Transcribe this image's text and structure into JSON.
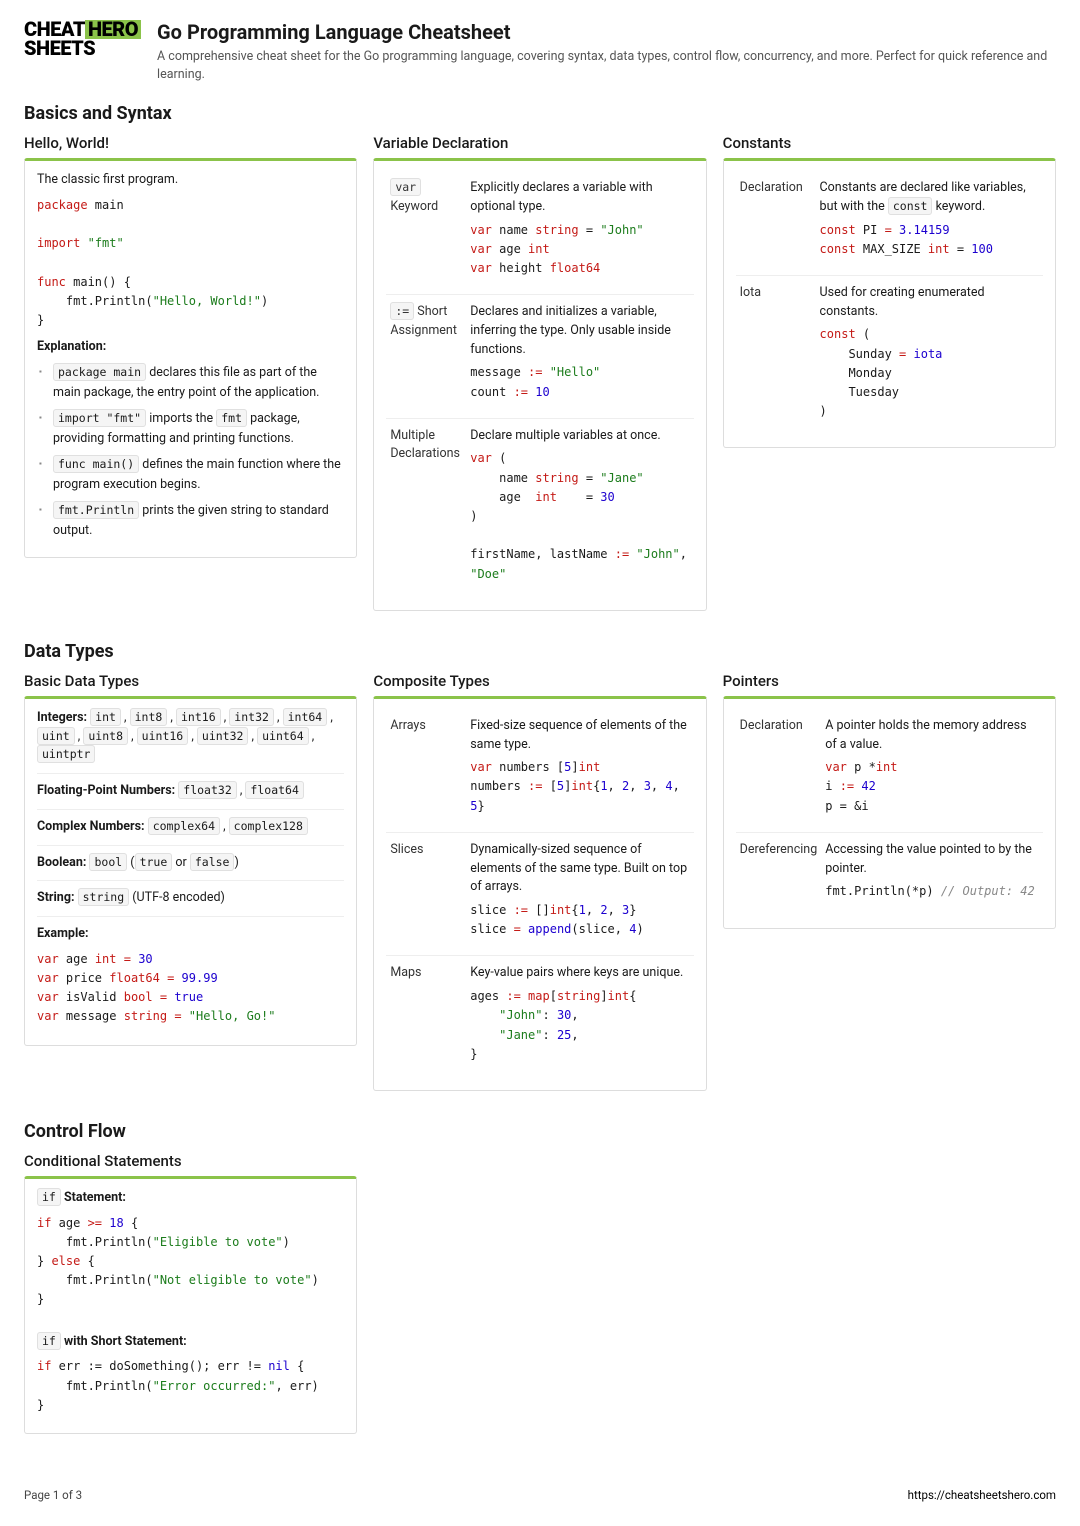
{
  "logo": {
    "part1": "CHEAT",
    "part2": "HERO",
    "part3": "SHEETS"
  },
  "title": "Go Programming Language Cheatsheet",
  "subtitle": "A comprehensive cheat sheet for the Go programming language, covering syntax, data types, control flow, concurrency, and more. Perfect for quick reference and learning.",
  "sections": {
    "basics": {
      "heading": "Basics and Syntax"
    },
    "datatypes": {
      "heading": "Data Types"
    },
    "controlflow": {
      "heading": "Control Flow"
    }
  },
  "hello": {
    "title": "Hello, World!",
    "intro": "The classic first program.",
    "explanation_heading": "Explanation:",
    "bullets": [
      {
        "pre": "package main",
        "post": " declares this file as part of the main package, the entry point of the application."
      },
      {
        "pre": "import \"fmt\"",
        "mid": " imports the ",
        "code2": "fmt",
        "post": " package, providing formatting and printing functions."
      },
      {
        "pre": "func main()",
        "post": " defines the main function where the program execution begins."
      },
      {
        "pre": "fmt.Println",
        "post": " prints the given string to standard output."
      }
    ]
  },
  "vardecl": {
    "title": "Variable Declaration",
    "rows": [
      {
        "label_code": "var",
        "label_text": " Keyword",
        "desc": "Explicitly declares a variable with optional type."
      },
      {
        "label_code": ":=",
        "label_text": " Short Assignment",
        "desc": "Declares and initializes a variable, inferring the type. Only usable inside functions."
      },
      {
        "label_text": "Multiple Declarations",
        "desc": "Declare multiple variables at once."
      }
    ]
  },
  "constants": {
    "title": "Constants",
    "rows": [
      {
        "label": "Declaration",
        "desc_pre": "Constants are declared like variables, but with the ",
        "desc_code": "const",
        "desc_post": " keyword."
      },
      {
        "label": "Iota",
        "desc": "Used for creating enumerated constants."
      }
    ]
  },
  "basictypes": {
    "title": "Basic Data Types",
    "integers_label": "Integers:",
    "integers": [
      "int",
      "int8",
      "int16",
      "int32",
      "int64",
      "uint",
      "uint8",
      "uint16",
      "uint32",
      "uint64",
      "uintptr"
    ],
    "float_label": "Floating-Point Numbers:",
    "floats": [
      "float32",
      "float64"
    ],
    "complex_label": "Complex Numbers:",
    "complex": [
      "complex64",
      "complex128"
    ],
    "bool_label": "Boolean:",
    "bool_code": "bool",
    "bool_extra_open": "(",
    "bool_true": "true",
    "bool_or": " or ",
    "bool_false": "false",
    "bool_extra_close": ")",
    "string_label": "String:",
    "string_code": "string",
    "string_note": " (UTF-8 encoded)",
    "example_label": "Example:"
  },
  "composite": {
    "title": "Composite Types",
    "rows": [
      {
        "label": "Arrays",
        "desc": "Fixed-size sequence of elements of the same type."
      },
      {
        "label": "Slices",
        "desc": "Dynamically-sized sequence of elements of the same type. Built on top of arrays."
      },
      {
        "label": "Maps",
        "desc": "Key-value pairs where keys are unique."
      }
    ]
  },
  "pointers": {
    "title": "Pointers",
    "rows": [
      {
        "label": "Declaration",
        "desc": "A pointer holds the memory address of a value."
      },
      {
        "label": "Dereferencing",
        "desc": "Accessing the value pointed to by the pointer."
      }
    ]
  },
  "conditional": {
    "title": "Conditional Statements",
    "if_label_code": "if",
    "if_label_text": " Statement:",
    "if2_label_code": "if",
    "if2_label_text": " with Short Statement:"
  },
  "footer": {
    "page": "Page 1 of 3",
    "url": "https://cheatsheetshero.com"
  }
}
